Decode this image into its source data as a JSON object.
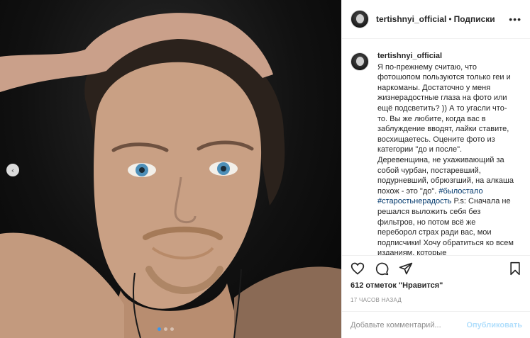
{
  "post": {
    "username": "tertishnyi_official",
    "follow_label": "Подписки",
    "separator": "•",
    "more_label": "•••",
    "carousel_prev": "‹",
    "caption_text": "Я по-прежнему считаю, что фотошопом пользуются только геи и наркоманы. Достаточно у меня жизнерадостные глаза на фото или ещё подсветить? )) А то угасли что-то. Вы же любите, когда вас в заблуждение вводят, лайки ставите, восхищаетесь. Оцените фото из категории \"до и после\". Деревенщина, не ухаживающий за собой чурбан, постаревший, подурневший, обрюзгший, на алкаша похож - это \"до\".",
    "hashtags": "#былостало #старостьнерадость",
    "caption_more": "P.s: Сначала не решался выложить себя без фильтров, но потом всё же переборол страх ради вас, мои подписчики! Хочу обратиться ко всем изданиям, которые",
    "likes": "612 отметок \"Нравится\"",
    "time": "17 часов назад",
    "comment_placeholder": "Добавьте комментарий...",
    "publish_label": "Опубликовать"
  },
  "colors": {
    "accent": "#3897f0",
    "link": "#00376b",
    "publish_disabled": "#b2dffc"
  },
  "icons": [
    "heart-icon",
    "comment-icon",
    "share-icon",
    "bookmark-icon"
  ]
}
